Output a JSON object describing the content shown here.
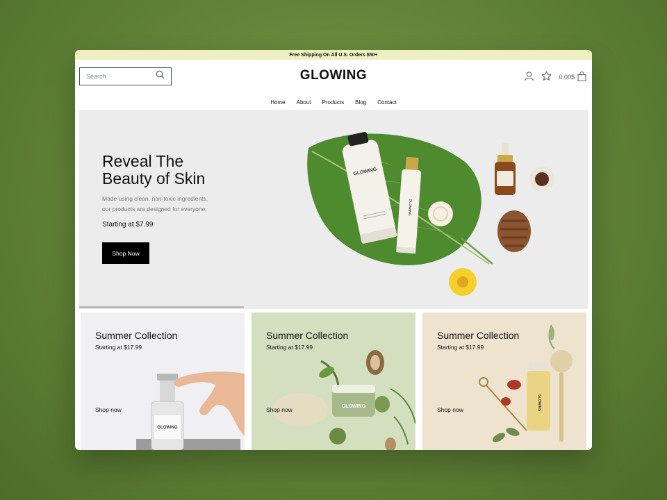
{
  "announcement": "Free Shipping On All U.S. Orders $50+",
  "header": {
    "search_placeholder": "Search",
    "logo": "GLOWING",
    "cart_total": "0,00$"
  },
  "nav": [
    "Home",
    "About",
    "Products",
    "Blog",
    "Contact"
  ],
  "hero": {
    "title_line1": "Reveal The",
    "title_line2": "Beauty of Skin",
    "subtitle_line1": "Made using clean, non-toxic ingredients,",
    "subtitle_line2": "our products are designed for everyone.",
    "price": "Starting at $7.99",
    "button": "Shop Now",
    "tube_brand": "GLOWING",
    "bottle_brand": "GLOWING"
  },
  "cards": [
    {
      "title": "Summer Collection",
      "price": "Starting at $17.99",
      "link": "Shop now",
      "bg": "#f0f0f2",
      "product_brand": "GLOWING"
    },
    {
      "title": "Summer Collection",
      "price": "Starting at $17.99",
      "link": "Shop now",
      "bg": "#d4dfc0",
      "product_brand": "GLOWING"
    },
    {
      "title": "Summer Collection",
      "price": "Starting at $17.99",
      "link": "Shop now",
      "bg": "#ede3cf",
      "product_brand": "GLOWING"
    }
  ],
  "icons": {
    "search": "search-icon",
    "account": "user-icon",
    "wishlist": "star-icon",
    "cart": "shopping-bag-icon"
  },
  "colors": {
    "announcement_bg": "#eef0c2",
    "button_bg": "#000000",
    "hero_bg": "#ececec"
  }
}
